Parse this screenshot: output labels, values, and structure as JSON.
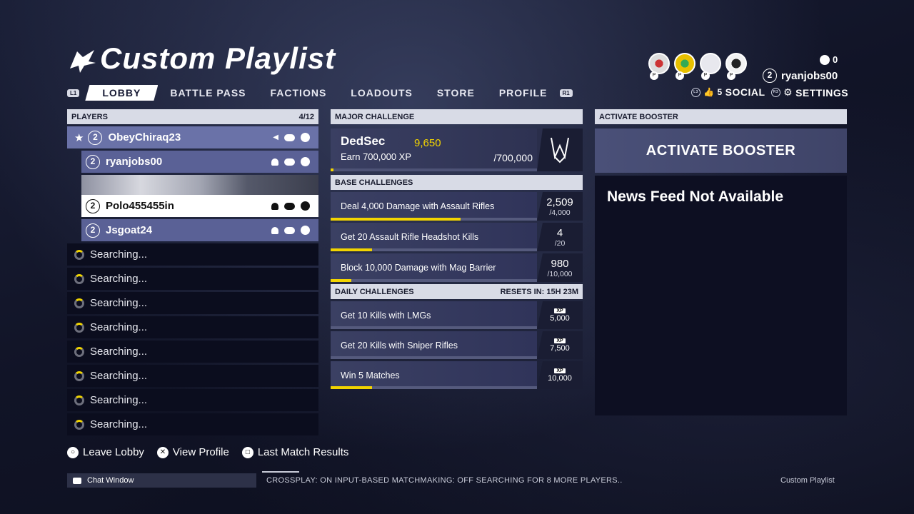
{
  "header": {
    "title": "Custom Playlist",
    "nav": {
      "l1": "L1",
      "r1": "R1",
      "tabs": [
        "LOBBY",
        "BATTLE PASS",
        "FACTIONS",
        "LOADOUTS",
        "STORE",
        "PROFILE"
      ],
      "active_tab": "LOBBY"
    }
  },
  "top_right": {
    "message_count": "0",
    "user_level": "2",
    "username": "ryanjobs00",
    "social_count": "5",
    "social_label": "SOCIAL",
    "settings_label": "SETTINGS",
    "l3": "L3",
    "r3": "R3"
  },
  "players": {
    "header": "PLAYERS",
    "count": "4/12",
    "list": [
      {
        "level": "2",
        "name": "ObeyChiraq23"
      },
      {
        "level": "2",
        "name": "ryanjobs00"
      },
      {
        "level": "2",
        "name": "Polo455455in"
      },
      {
        "level": "2",
        "name": "Jsgoat24"
      }
    ],
    "searching_label": "Searching..."
  },
  "major_challenge": {
    "header": "MAJOR CHALLENGE",
    "name": "DedSec",
    "points": "9,650",
    "description": "Earn 700,000 XP",
    "goal": "/700,000",
    "progress": 0.014
  },
  "base_challenges": {
    "header": "BASE CHALLENGES",
    "items": [
      {
        "label": "Deal 4,000 Damage with Assault Rifles",
        "current": "2,509",
        "max": "/4,000",
        "progress": 0.63
      },
      {
        "label": "Get 20 Assault Rifle Headshot Kills",
        "current": "4",
        "max": "/20",
        "progress": 0.2
      },
      {
        "label": "Block 10,000 Damage with Mag Barrier",
        "current": "980",
        "max": "/10,000",
        "progress": 0.1
      }
    ]
  },
  "daily_challenges": {
    "header": "DAILY CHALLENGES",
    "resets": "RESETS IN: 15H 23M",
    "xp_label": "XP",
    "items": [
      {
        "label": "Get 10 Kills with LMGs",
        "xp": "5,000",
        "progress": 0.0
      },
      {
        "label": "Get 20 Kills with Sniper Rifles",
        "xp": "7,500",
        "progress": 0.0
      },
      {
        "label": "Win 5 Matches",
        "xp": "10,000",
        "progress": 0.2
      }
    ]
  },
  "booster": {
    "header": "ACTIVATE BOOSTER",
    "button": "ACTIVATE BOOSTER",
    "news": "News Feed Not Available"
  },
  "footer": {
    "actions": [
      "Leave Lobby",
      "View Profile",
      "Last Match Results"
    ],
    "chat": "Chat Window",
    "status": "CROSSPLAY: ON  INPUT-BASED MATCHMAKING: OFF  SEARCHING FOR 8 MORE PLAYERS..",
    "mode": "Custom Playlist"
  },
  "colors": {
    "accent_yellow": "#f2d400",
    "panel_header": "#d8dbe6",
    "player_row": "#5a6196"
  }
}
